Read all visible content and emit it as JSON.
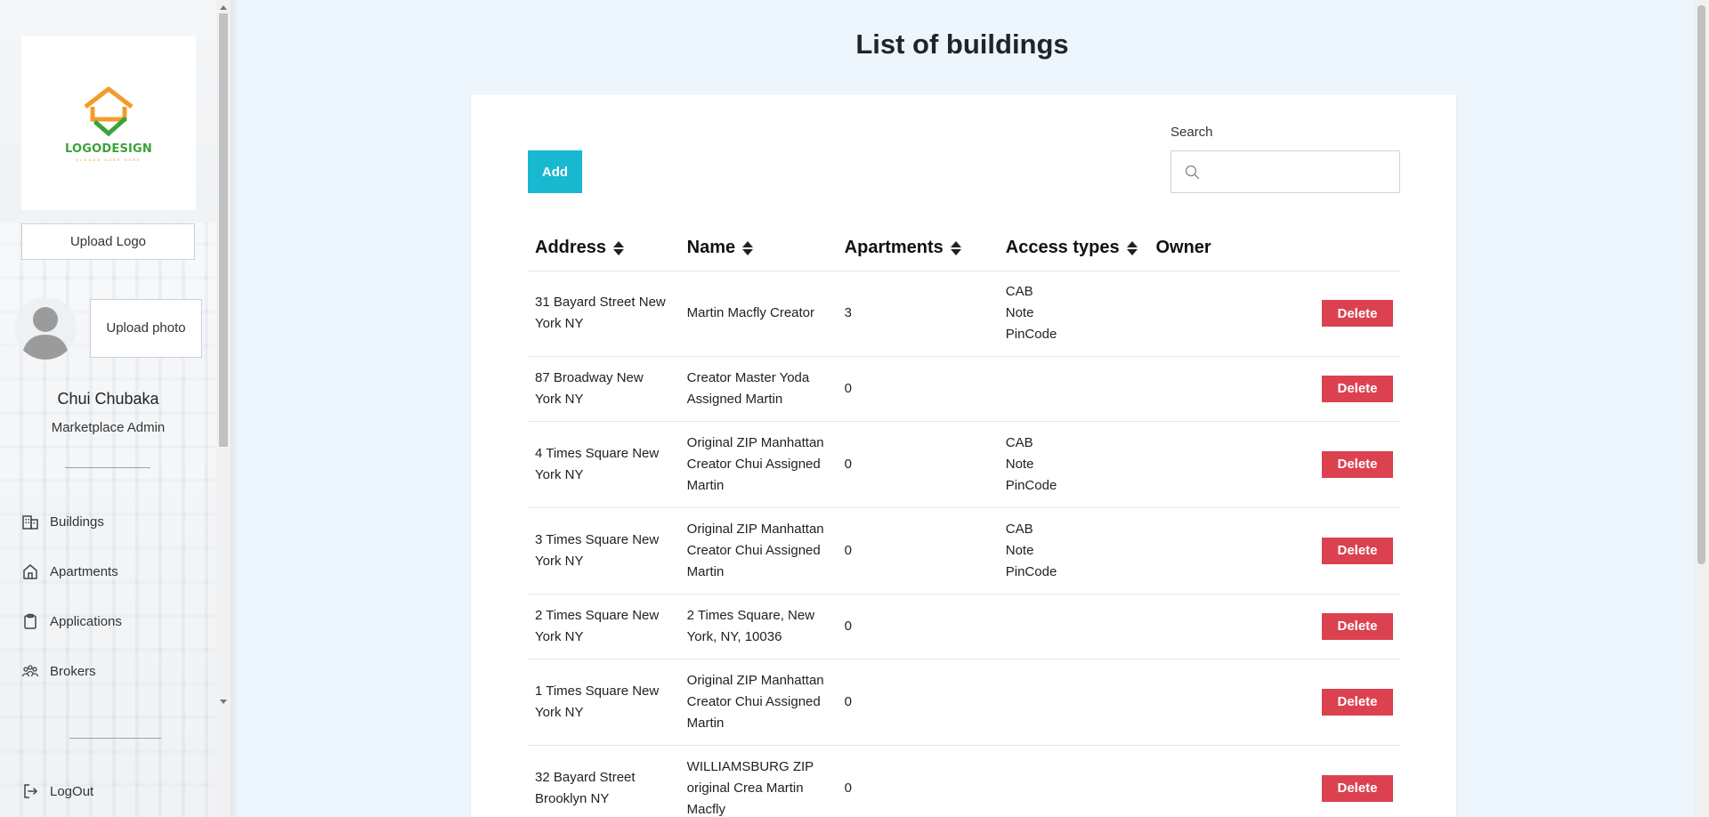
{
  "logo": {
    "text": "LOGODESIGN",
    "slogan": "SLOGAN GOES HERE"
  },
  "sidebar": {
    "upload_logo": "Upload Logo",
    "upload_photo": "Upload photo",
    "user_name": "Chui Chubaka",
    "user_role": "Marketplace Admin",
    "items": [
      {
        "label": "Buildings",
        "icon": "building-icon"
      },
      {
        "label": "Apartments",
        "icon": "home-icon"
      },
      {
        "label": "Applications",
        "icon": "clipboard-icon"
      },
      {
        "label": "Brokers",
        "icon": "people-icon"
      }
    ],
    "logout": "LogOut"
  },
  "main": {
    "title": "List of buildings",
    "add_label": "Add",
    "search_label": "Search",
    "search_value": "",
    "columns": [
      "Address",
      "Name",
      "Apartments",
      "Access types",
      "Owner"
    ],
    "delete_label": "Delete",
    "rows": [
      {
        "address": "31 Bayard Street New York NY",
        "name": "Martin Macfly Creator",
        "apartments": "3",
        "access": [
          "CAB",
          "Note",
          "PinCode"
        ],
        "owner": ""
      },
      {
        "address": "87 Broadway New York NY",
        "name": "Creator Master Yoda Assigned Martin",
        "apartments": "0",
        "access": [],
        "owner": ""
      },
      {
        "address": "4 Times Square New York NY",
        "name": "Original ZIP Manhattan Creator Chui Assigned Martin",
        "apartments": "0",
        "access": [
          "CAB",
          "Note",
          "PinCode"
        ],
        "owner": ""
      },
      {
        "address": "3 Times Square New York NY",
        "name": "Original ZIP Manhattan Creator Chui Assigned Martin",
        "apartments": "0",
        "access": [
          "CAB",
          "Note",
          "PinCode"
        ],
        "owner": ""
      },
      {
        "address": "2 Times Square New York NY",
        "name": "2 Times Square, New York, NY, 10036",
        "apartments": "0",
        "access": [],
        "owner": ""
      },
      {
        "address": "1 Times Square New York NY",
        "name": "Original ZIP Manhattan Creator Chui Assigned Martin",
        "apartments": "0",
        "access": [],
        "owner": ""
      },
      {
        "address": "32 Bayard Street Brooklyn NY",
        "name": "WILLIAMSBURG ZIP original Crea Martin Macfly",
        "apartments": "0",
        "access": [],
        "owner": ""
      }
    ]
  },
  "colors": {
    "accent": "#17b8d0",
    "danger": "#dc4150",
    "logo_orange": "#f39c2a",
    "logo_green": "#3aa23a"
  }
}
